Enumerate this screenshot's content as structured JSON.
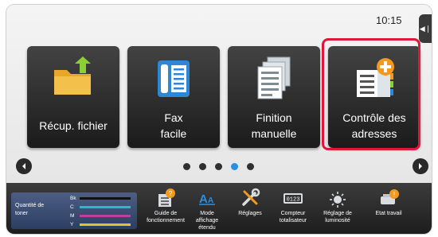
{
  "status": {
    "time": "10:15"
  },
  "tiles": [
    {
      "label": "Récup. fichier",
      "icon": "folder-upload-icon"
    },
    {
      "label": "Fax\nfacile",
      "icon": "fax-phone-icon"
    },
    {
      "label": "Finition\nmanuelle",
      "icon": "finishing-pages-icon"
    },
    {
      "label": "Contrôle des\nadresses",
      "icon": "address-book-add-icon",
      "highlighted": true
    }
  ],
  "pager": {
    "page_count": 5,
    "active_index": 3
  },
  "toner": {
    "label": "Quantité de\ntoner",
    "rows": [
      {
        "name": "Bk",
        "color": "#111111"
      },
      {
        "name": "C",
        "color": "#2bb9c9"
      },
      {
        "name": "M",
        "color": "#c03f9e"
      },
      {
        "name": "Y",
        "color": "#d8c72d"
      }
    ]
  },
  "taskbar": [
    {
      "label": "Guide de\nfonctionnement",
      "icon": "help-book-icon"
    },
    {
      "label": "Mode\naffichage\nétendu",
      "icon": "zoom-text-icon"
    },
    {
      "label": "Réglages",
      "icon": "tools-icon"
    },
    {
      "label": "Compteur\ntotalisateur",
      "icon": "counter-icon"
    },
    {
      "label": "Réglage de\nluminosité",
      "icon": "brightness-icon"
    },
    {
      "label": "Etat travail",
      "icon": "job-status-icon"
    }
  ],
  "colors": {
    "highlight": "#e0163a",
    "accent_blue": "#2b8fe0",
    "accent_orange": "#f39a1e"
  }
}
